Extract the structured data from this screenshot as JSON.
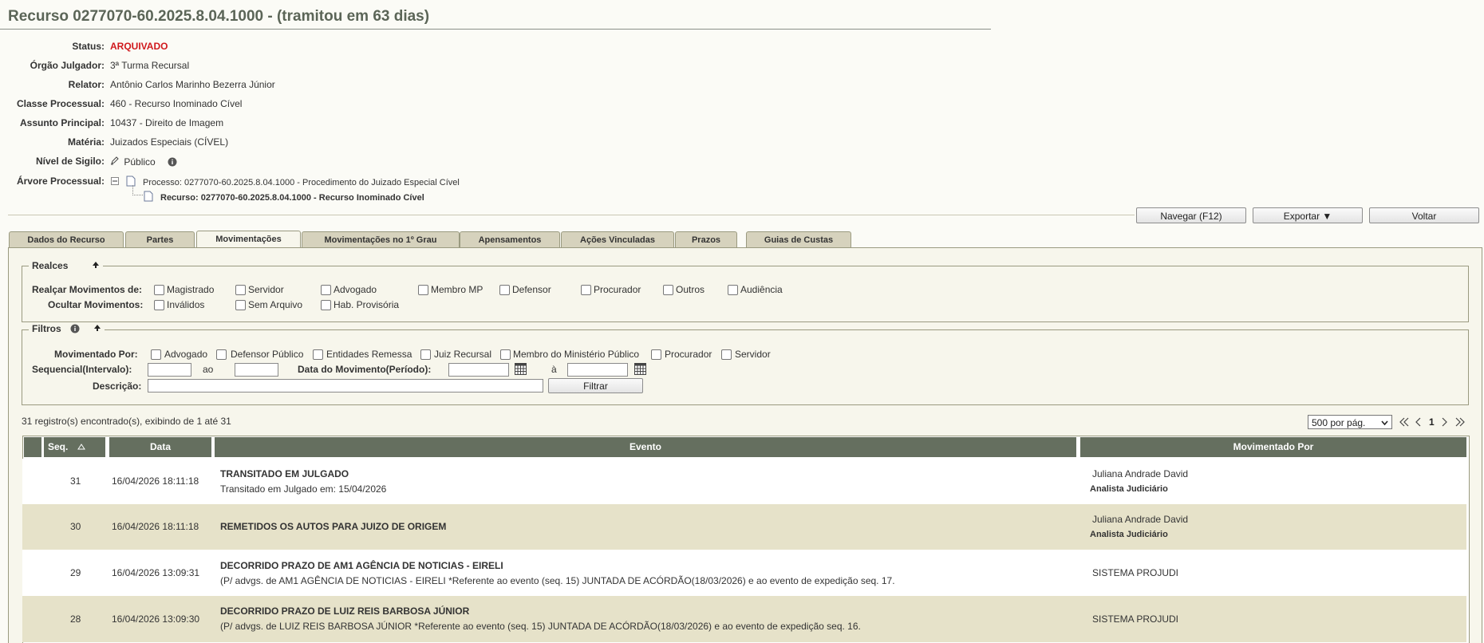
{
  "header": {
    "title": "Recurso 0277070-60.2025.8.04.1000   -   (tramitou em 63 dias)"
  },
  "info": {
    "status_label": "Status:",
    "status_value": "ARQUIVADO",
    "orgao_label": "Órgão Julgador:",
    "orgao_value": "3ª Turma Recursal",
    "relator_label": "Relator:",
    "relator_value": "Antônio Carlos Marinho Bezerra Júnior",
    "classe_label": "Classe Processual:",
    "classe_value": "460 - Recurso Inominado Cível",
    "assunto_label": "Assunto Principal:",
    "assunto_value": "10437 - Direito de Imagem",
    "materia_label": "Matéria:",
    "materia_value": "Juizados Especiais (CÍVEL)",
    "sigilo_label": "Nível de Sigilo:",
    "sigilo_value": "Público",
    "arvore_label": "Árvore Processual:",
    "arvore_processo": "Processo: 0277070-60.2025.8.04.1000 - Procedimento do Juizado Especial Cível",
    "arvore_recurso": "Recurso: 0277070-60.2025.8.04.1000 - Recurso Inominado Cível"
  },
  "actions": {
    "navegar": "Navegar (F12)",
    "exportar": "Exportar ▼",
    "voltar": "Voltar"
  },
  "tabs": [
    "Dados do Recurso",
    "Partes",
    "Movimentações",
    "Movimentações no 1º Grau",
    "Apensamentos",
    "Ações Vinculadas",
    "Prazos",
    "Guias de Custas"
  ],
  "realces": {
    "legend": "Realces",
    "realcar_label": "Realçar Movimentos de:",
    "realcar_opts": [
      "Magistrado",
      "Servidor",
      "Advogado",
      "Membro MP",
      "Defensor",
      "Procurador",
      "Outros",
      "Audiência"
    ],
    "ocultar_label": "Ocultar Movimentos:",
    "ocultar_opts": [
      "Inválidos",
      "Sem Arquivo",
      "Hab. Provisória"
    ]
  },
  "filtros": {
    "legend": "Filtros",
    "mov_por_label": "Movimentado Por:",
    "mov_por_opts": [
      "Advogado",
      "Defensor Público",
      "Entidades Remessa",
      "Juiz Recursal",
      "Membro do Ministério Público",
      "Procurador",
      "Servidor"
    ],
    "seq_label": "Sequencial(Intervalo):",
    "ao": "ao",
    "data_label": "Data do Movimento(Período):",
    "a": "à",
    "desc_label": "Descrição:",
    "filtrar": "Filtrar"
  },
  "results": {
    "summary": "31 registro(s) encontrado(s), exibindo de 1 até 31",
    "per_page": "500 por pág.",
    "page": "1"
  },
  "table": {
    "headers": [
      "Seq.",
      "Data",
      "Evento",
      "Movimentado Por"
    ],
    "rows": [
      {
        "seq": "31",
        "data": "16/04/2026 18:11:18",
        "evento": "TRANSITADO EM JULGADO",
        "detalhe": "Transitado em Julgado em: 15/04/2026",
        "por": "Juliana Andrade David",
        "cargo": "Analista Judiciário"
      },
      {
        "seq": "30",
        "data": "16/04/2026 18:11:18",
        "evento": "REMETIDOS OS AUTOS PARA JUIZO DE ORIGEM",
        "detalhe": "",
        "por": "Juliana Andrade David",
        "cargo": "Analista Judiciário"
      },
      {
        "seq": "29",
        "data": "16/04/2026 13:09:31",
        "evento": "DECORRIDO PRAZO DE AM1 AGÊNCIA DE NOTICIAS - EIRELI",
        "detalhe": "(P/ advgs. de AM1 AGÊNCIA DE NOTICIAS - EIRELI *Referente ao evento (seq. 15) JUNTADA DE ACÓRDÃO(18/03/2026) e ao evento de expedição seq. 17.",
        "por": "SISTEMA PROJUDI",
        "cargo": ""
      },
      {
        "seq": "28",
        "data": "16/04/2026 13:09:30",
        "evento": "DECORRIDO PRAZO DE LUIZ REIS BARBOSA JÚNIOR",
        "detalhe": "(P/ advgs. de LUIZ REIS BARBOSA JÚNIOR *Referente ao evento (seq. 15) JUNTADA DE ACÓRDÃO(18/03/2026) e ao evento de expedição seq. 16.",
        "por": "SISTEMA PROJUDI",
        "cargo": ""
      }
    ]
  }
}
